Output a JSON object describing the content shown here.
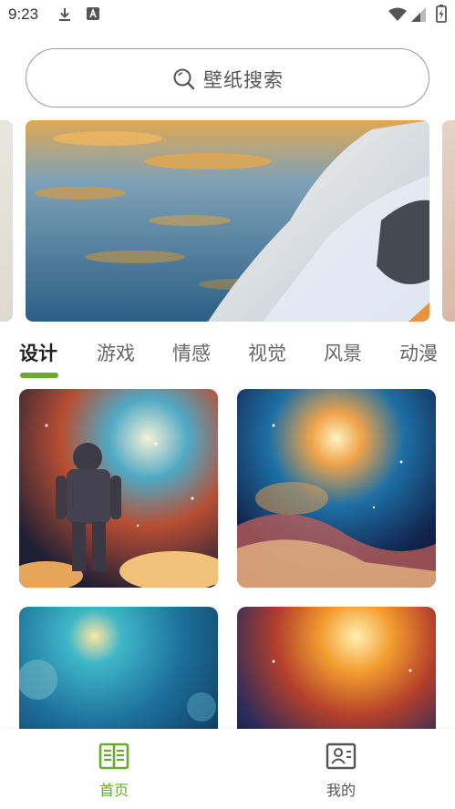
{
  "status_bar": {
    "time": "9:23",
    "icons": [
      "download-icon",
      "font-badge-icon",
      "wifi-icon",
      "signal-icon",
      "battery-charging-icon"
    ]
  },
  "search": {
    "placeholder": "壁纸搜索",
    "icon": "search-icon"
  },
  "tabs": [
    {
      "label": "设计",
      "active": true
    },
    {
      "label": "游戏",
      "active": false
    },
    {
      "label": "情感",
      "active": false
    },
    {
      "label": "视觉",
      "active": false
    },
    {
      "label": "风景",
      "active": false
    },
    {
      "label": "动漫",
      "active": false
    }
  ],
  "bottom_nav": [
    {
      "label": "首页",
      "icon": "book-icon",
      "active": true
    },
    {
      "label": "我的",
      "icon": "contact-card-icon",
      "active": false
    }
  ],
  "colors": {
    "accent": "#6aab2e",
    "text_inactive": "#555555"
  }
}
